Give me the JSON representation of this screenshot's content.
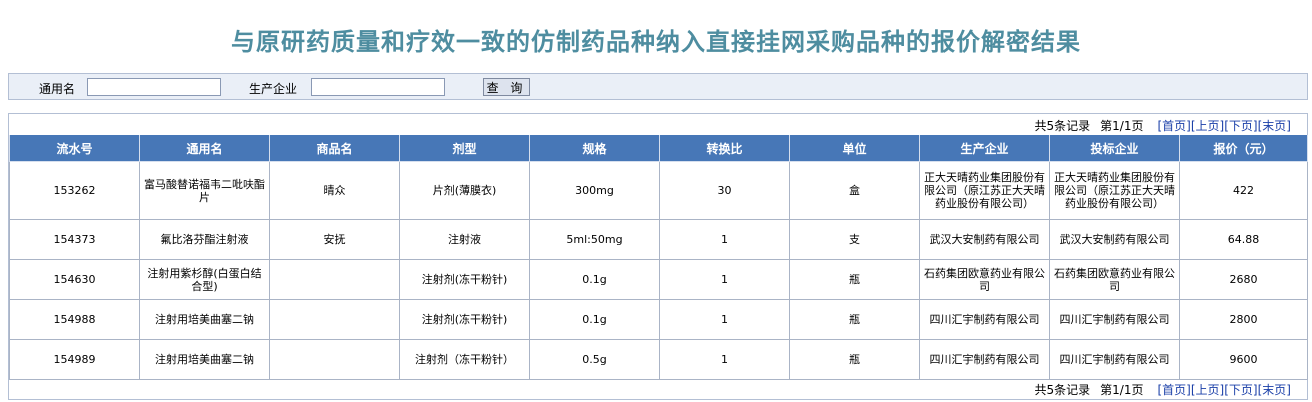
{
  "page": {
    "title": "与原研药质量和疗效一致的仿制药品种纳入直接挂网采购品种的报价解密结果"
  },
  "search": {
    "generic_name_label": "通用名",
    "generic_name_value": "",
    "manufacturer_label": "生产企业",
    "manufacturer_value": "",
    "query_button": "查 询"
  },
  "pager": {
    "count_text": "共5条记录",
    "page_text": "第1/1页",
    "first": "[首页]",
    "prev": "[上页]",
    "next": "[下页]",
    "last": "[末页]"
  },
  "table": {
    "headers": [
      "流水号",
      "通用名",
      "商品名",
      "剂型",
      "规格",
      "转换比",
      "单位",
      "生产企业",
      "投标企业",
      "报价（元）"
    ],
    "rows": [
      [
        "153262",
        "富马酸替诺福韦二吡呋酯片",
        "晴众",
        "片剂(薄膜衣)",
        "300mg",
        "30",
        "盒",
        "正大天晴药业集团股份有限公司（原江苏正大天晴药业股份有限公司）",
        "正大天晴药业集团股份有限公司（原江苏正大天晴药业股份有限公司）",
        "422"
      ],
      [
        "154373",
        "氟比洛芬酯注射液",
        "安抚",
        "注射液",
        "5ml:50mg",
        "1",
        "支",
        "武汉大安制药有限公司",
        "武汉大安制药有限公司",
        "64.88"
      ],
      [
        "154630",
        "注射用紫杉醇(白蛋白结合型)",
        "",
        "注射剂(冻干粉针)",
        "0.1g",
        "1",
        "瓶",
        "石药集团欧意药业有限公司",
        "石药集团欧意药业有限公司",
        "2680"
      ],
      [
        "154988",
        "注射用培美曲塞二钠",
        "",
        "注射剂(冻干粉针)",
        "0.1g",
        "1",
        "瓶",
        "四川汇宇制药有限公司",
        "四川汇宇制药有限公司",
        "2800"
      ],
      [
        "154989",
        "注射用培美曲塞二钠",
        "",
        "注射剂（冻干粉针）",
        "0.5g",
        "1",
        "瓶",
        "四川汇宇制药有限公司",
        "四川汇宇制药有限公司",
        "9600"
      ]
    ]
  },
  "colors": {
    "title": "#4e8da0",
    "header_bg": "#4777b7",
    "search_bg": "#eaeff7",
    "link": "#1a3fa8"
  }
}
